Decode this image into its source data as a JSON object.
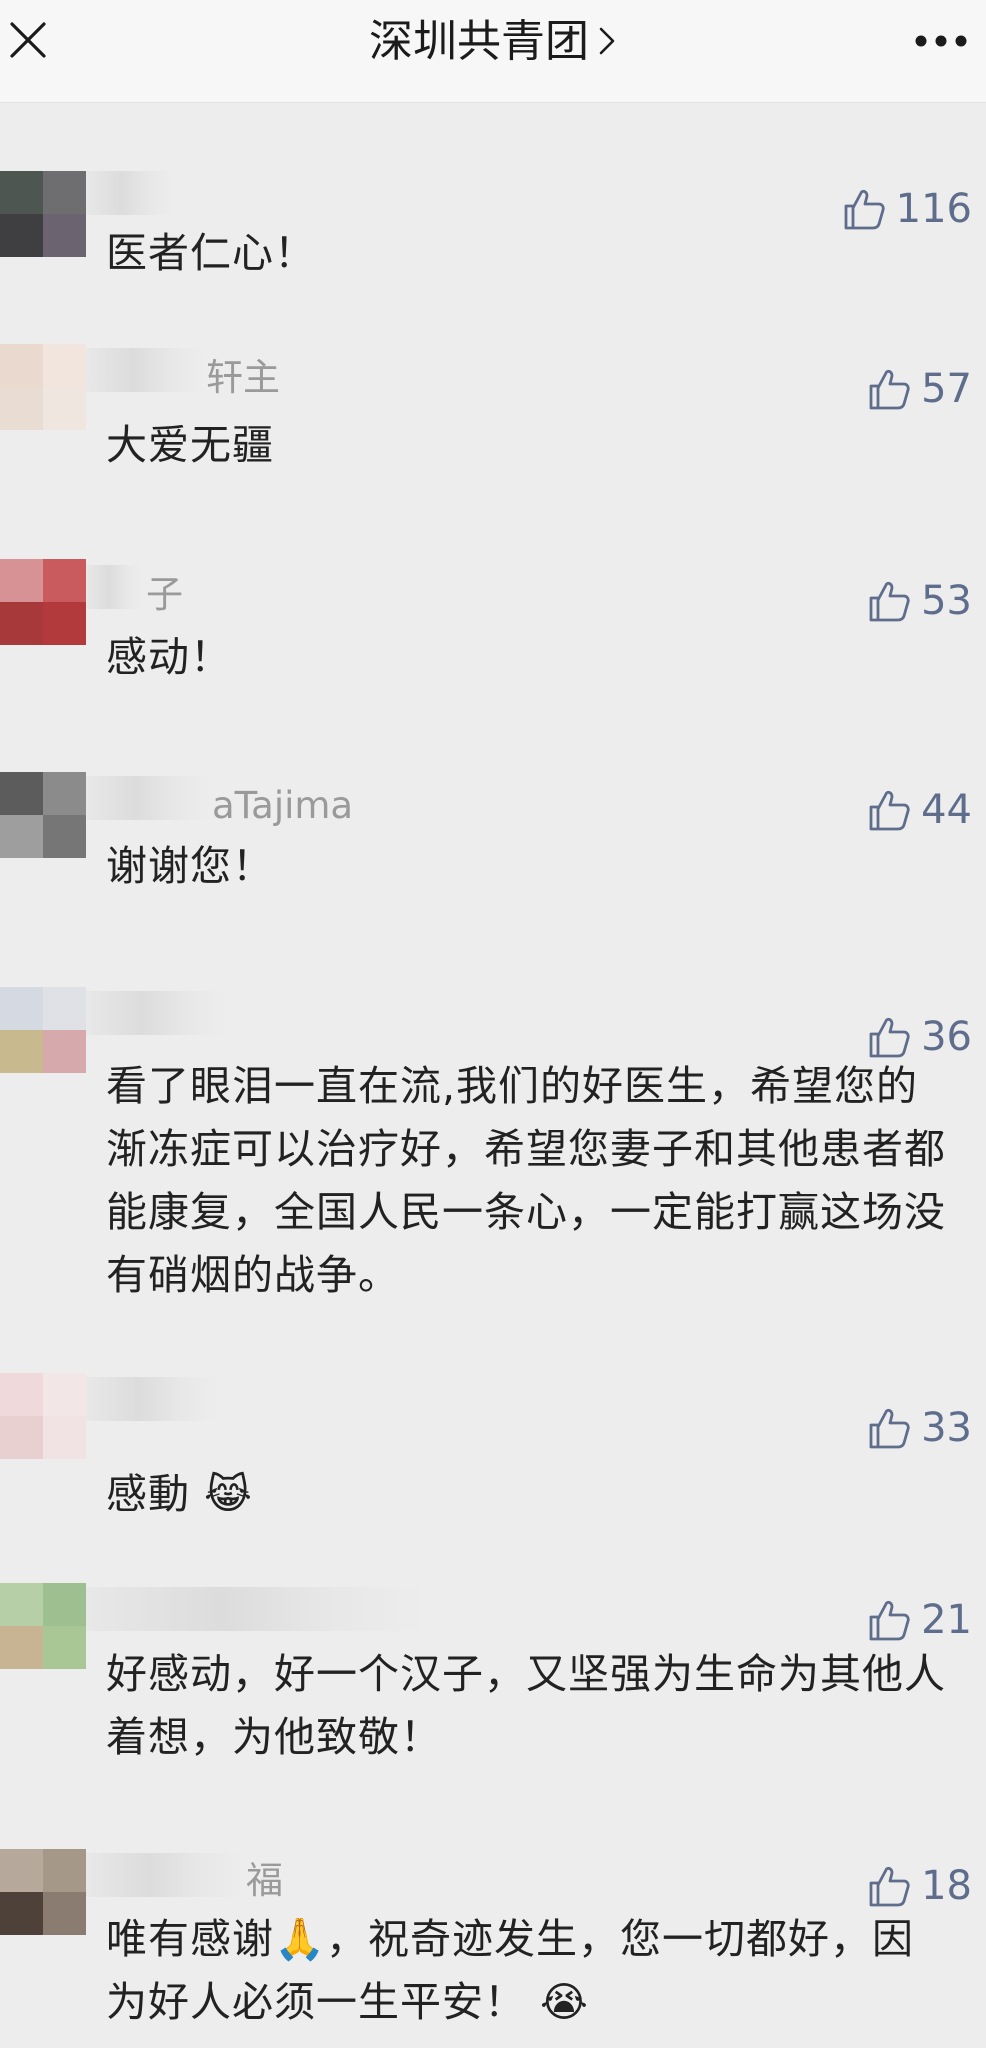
{
  "nav": {
    "title": "深圳共青团",
    "close_icon": "close-icon",
    "more_icon": "more-dots-icon",
    "chevron_icon": "chevron-right-icon"
  },
  "colors": {
    "background": "#ededed",
    "like_color": "#5f6d8c",
    "text": "#222222",
    "nickname": "#9a9a9a"
  },
  "comments": [
    {
      "nickname": "",
      "likes": "116",
      "text": "医者仁心！"
    },
    {
      "nickname": "轩主",
      "likes": "57",
      "text": "大爱无疆"
    },
    {
      "nickname": "子",
      "likes": "53",
      "text": "感动！"
    },
    {
      "nickname": "aTajima",
      "likes": "44",
      "text": "谢谢您！"
    },
    {
      "nickname": "",
      "likes": "36",
      "text": "看了眼泪一直在流,我们的好医生，希望您的渐冻症可以治疗好，希望您妻子和其他患者都能康复，全国人民一条心，一定能打赢这场没有硝烟的战争。"
    },
    {
      "nickname": "",
      "likes": "33",
      "text": "感動 😹"
    },
    {
      "nickname": "",
      "likes": "21",
      "text": "好感动，好一个汉子，又坚强为生命为其他人着想，为他致敬！"
    },
    {
      "nickname": "福",
      "likes": "18",
      "text": "唯有感谢🙏，祝奇迹发生，您一切都好，因为好人必须一生平安！ 😭"
    }
  ]
}
